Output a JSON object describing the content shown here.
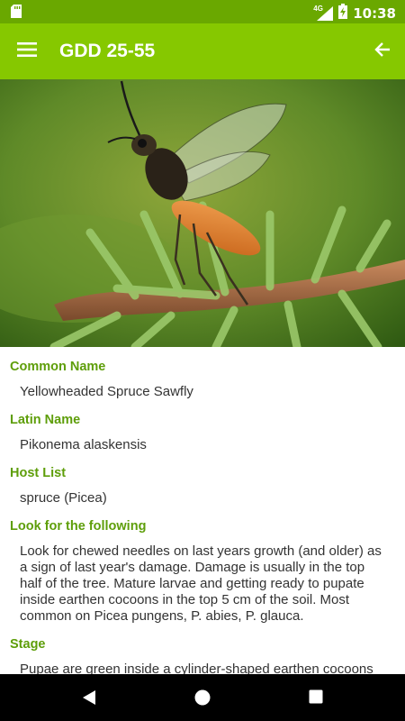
{
  "status_bar": {
    "network": "4G",
    "time": "10:38",
    "icons": [
      "sd-card-icon",
      "signal-icon",
      "battery-charging-icon"
    ]
  },
  "app_bar": {
    "title": "GDD 25-55",
    "icons": [
      "menu-icon",
      "back-arrow-icon"
    ]
  },
  "hero_image": {
    "subject": "yellowheaded spruce sawfly on spruce twig photo"
  },
  "sections": [
    {
      "label": "Common Name",
      "value": "Yellowheaded Spruce Sawfly"
    },
    {
      "label": "Latin Name",
      "value": "Pikonema alaskensis"
    },
    {
      "label": "Host List",
      "value": "spruce (Picea)"
    },
    {
      "label": "Look for the following",
      "value": "Look for chewed needles on last years growth (and older) as a sign of last year's damage. Damage is usually in the top half of the tree.  Mature larvae and getting ready to pupate inside earthen cocoons in the top 5 cm of the soil. Most common on Picea pungens, P. abies, P. glauca."
    },
    {
      "label": "Stage",
      "value": "Pupae are green inside a cylinder-shaped earthen cocoons"
    }
  ],
  "colors": {
    "status_bar": "#6aa800",
    "app_bar": "#86c800",
    "label_text": "#5e9e0a"
  },
  "nav_bar": {
    "icons": [
      "back-triangle-icon",
      "home-circle-icon",
      "recents-square-icon"
    ]
  }
}
